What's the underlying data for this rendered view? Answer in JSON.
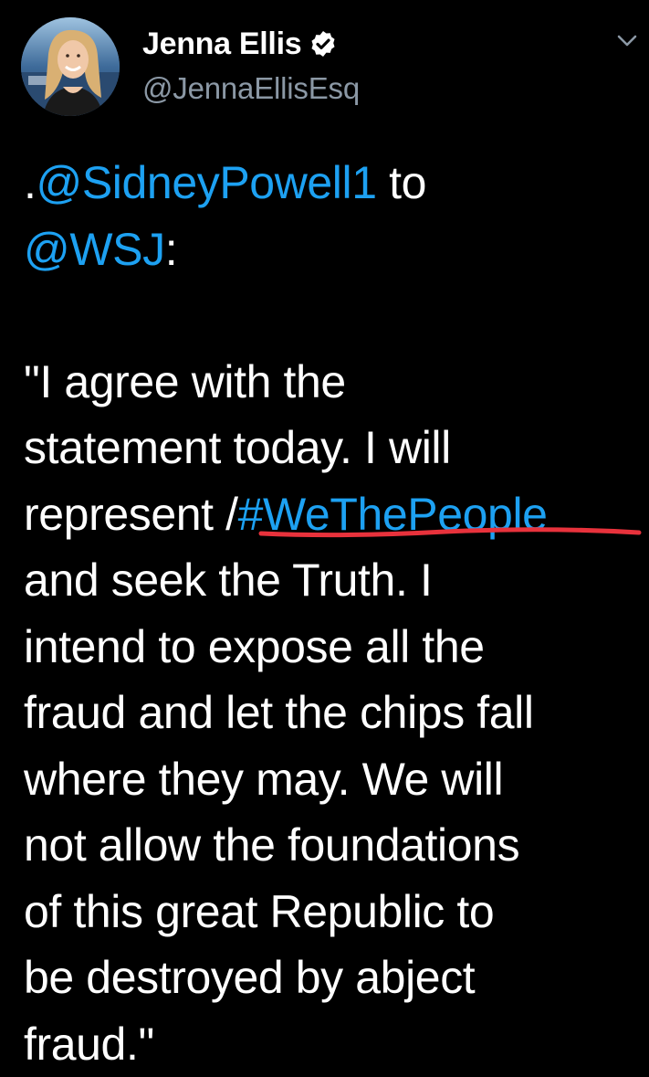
{
  "tweet": {
    "display_name": "Jenna Ellis",
    "handle": "@JennaEllisEsq",
    "verified": true,
    "lines": [
      {
        "pre": ".",
        "mention": "@SidneyPowell1",
        "post": " to"
      },
      {
        "pre": "",
        "mention": "@WSJ",
        "post": ":"
      },
      {
        "text": ""
      },
      {
        "text": "\"I agree with the"
      },
      {
        "text": "statement today. I will"
      },
      {
        "pre": "represent /",
        "hashtag": "#WeThePeople",
        "post": ""
      },
      {
        "text": "and seek the Truth. I"
      },
      {
        "text": "intend to expose all the"
      },
      {
        "text": "fraud and let the chips fall"
      },
      {
        "text": "where they may. We will"
      },
      {
        "text": "not allow the foundations"
      },
      {
        "text": "of this great Republic to"
      },
      {
        "text": "be destroyed by abject"
      },
      {
        "text": "fraud.\""
      }
    ]
  },
  "icons": {
    "verified": "verified-badge-icon",
    "menu": "chevron-down-icon",
    "avatar": "profile-photo"
  },
  "colors": {
    "background": "#000000",
    "text": "#ffffff",
    "secondary": "#8b98a5",
    "link": "#1da1f2",
    "annotation": "#e8323c"
  }
}
